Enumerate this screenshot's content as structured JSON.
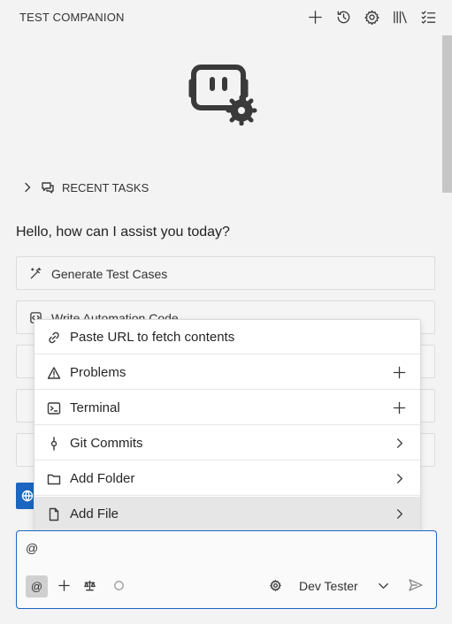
{
  "header": {
    "title": "TEST COMPANION"
  },
  "toolbar": {
    "icons": [
      "plus-icon",
      "history-icon",
      "gear-icon",
      "library-icon",
      "checklist-icon"
    ]
  },
  "recent_tasks": {
    "label": "RECENT TASKS"
  },
  "greeting": "Hello, how can I assist you today?",
  "actions": [
    {
      "label": "Generate Test Cases",
      "icon": "wand-icon"
    },
    {
      "label": "Write Automation Code",
      "icon": "code-icon"
    }
  ],
  "context_menu": {
    "items": [
      {
        "label": "Paste URL to fetch contents",
        "icon": "link-icon",
        "right": ""
      },
      {
        "label": "Problems",
        "icon": "warning-icon",
        "right": "plus"
      },
      {
        "label": "Terminal",
        "icon": "terminal-icon",
        "right": "plus"
      },
      {
        "label": "Git Commits",
        "icon": "git-commit-icon",
        "right": "chevron"
      },
      {
        "label": "Add Folder",
        "icon": "folder-icon",
        "right": "chevron"
      },
      {
        "label": "Add File",
        "icon": "file-icon",
        "right": "chevron",
        "selected": true
      }
    ]
  },
  "input": {
    "value": "@",
    "at_button": "@",
    "model": "Dev Tester"
  },
  "colors": {
    "accent": "#1a66c0",
    "background": "#f3f3f3",
    "selected_row": "#e6e6e6"
  }
}
